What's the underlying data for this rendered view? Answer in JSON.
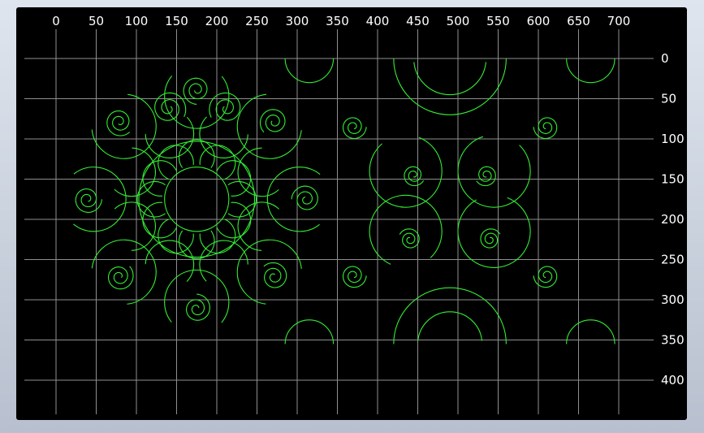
{
  "viewport": {
    "background": "#000000",
    "grid_color": "#8f8f8f",
    "pattern_color": "#33ee33",
    "label_color": "#ffffff"
  },
  "x_axis": {
    "ticks": [
      "0",
      "50",
      "100",
      "150",
      "200",
      "250",
      "300",
      "350",
      "400",
      "450",
      "500",
      "550",
      "600",
      "650",
      "700"
    ]
  },
  "y_axis": {
    "ticks": [
      "0",
      "50",
      "100",
      "150",
      "200",
      "250",
      "300",
      "350",
      "400"
    ]
  },
  "shapes": [
    {
      "name": "circular-rosette",
      "center": [
        175,
        175
      ],
      "description": "round rosette of scrolls around a central ring"
    },
    {
      "name": "lotus-tile",
      "center": [
        490,
        175
      ],
      "description": "mirrored lotus tile with half-medallions top and bottom"
    }
  ]
}
